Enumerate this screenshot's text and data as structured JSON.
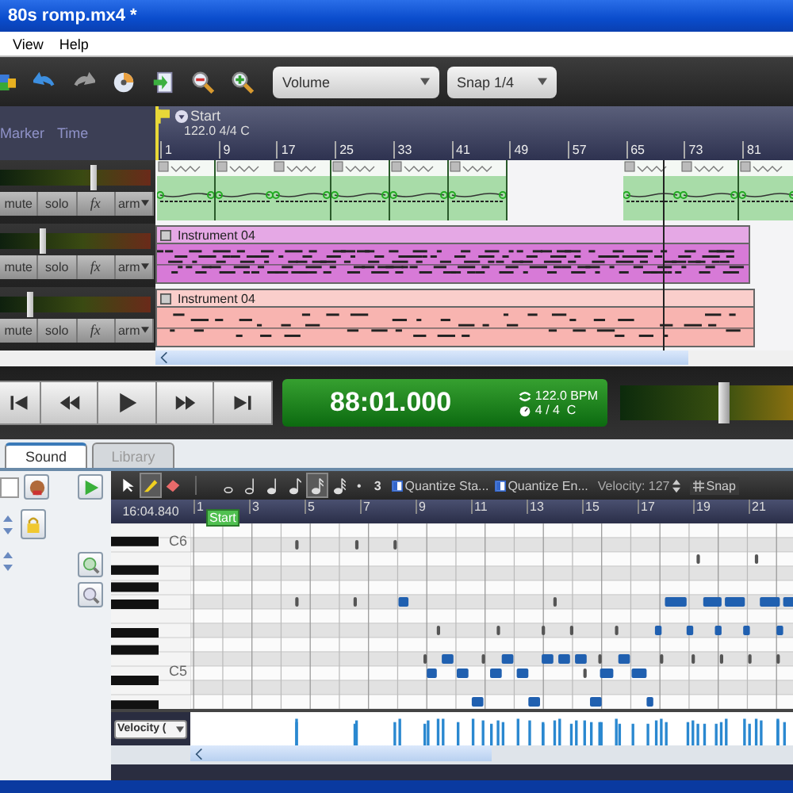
{
  "window": {
    "title": "80s romp.mx4 *"
  },
  "menu": [
    "View",
    "Help"
  ],
  "toolbar": {
    "dropdowns": [
      {
        "value": "Volume"
      },
      {
        "value": "Snap 1/4"
      }
    ]
  },
  "track_header": {
    "buttons": [
      "Marker",
      "Time"
    ]
  },
  "ruler": {
    "marker": "Start",
    "tempo": "122.0 4/4 C",
    "bars": [
      "1",
      "9",
      "17",
      "25",
      "33",
      "41",
      "49",
      "57",
      "65",
      "73",
      "81"
    ]
  },
  "tracks": [
    {
      "kind": "pattern",
      "level": 0.62,
      "color": "#a8dca8",
      "buttons": [
        "mute",
        "solo",
        "fx",
        "arm"
      ]
    },
    {
      "kind": "instrument",
      "name": "Instrument 04",
      "level": 0.28,
      "color": "#d77ad7",
      "buttons": [
        "mute",
        "solo",
        "fx",
        "arm"
      ]
    },
    {
      "kind": "instrument",
      "name": "Instrument 04",
      "level": 0.2,
      "color": "#f8b4b0",
      "buttons": [
        "mute",
        "solo",
        "fx",
        "arm"
      ]
    }
  ],
  "transport": {
    "time": "88:01.000",
    "tempo": "122.0 BPM",
    "meter": "4 / 4  C",
    "master": {
      "level": 0.6
    }
  },
  "tabs": [
    {
      "label": "Sound",
      "selected": true
    },
    {
      "label": "Library",
      "selected": false
    }
  ],
  "piano_roll": {
    "tools": [
      {
        "kind": "pointer",
        "selected": false
      },
      {
        "kind": "pencil",
        "selected": true
      },
      {
        "kind": "eraser",
        "selected": false
      }
    ],
    "durations": [
      {
        "kind": "whole",
        "selected": false
      },
      {
        "kind": "half",
        "selected": false
      },
      {
        "kind": "quarter",
        "selected": false
      },
      {
        "kind": "eighth",
        "selected": false
      },
      {
        "kind": "sixteenth",
        "selected": true
      },
      {
        "kind": "thirtysecond",
        "selected": false
      }
    ],
    "dot": "•",
    "triplet": "3",
    "quantize": [
      "Quantize Sta...",
      "Quantize En..."
    ],
    "velocity": "Velocity: 127",
    "snap": "Snap",
    "position": "16:04.840",
    "marker": "Start",
    "bars": [
      "1",
      "3",
      "5",
      "7",
      "9",
      "11",
      "13",
      "15",
      "17",
      "19",
      "21"
    ],
    "keys": [
      "C6",
      "C5"
    ],
    "lane_select": "Velocity ("
  }
}
